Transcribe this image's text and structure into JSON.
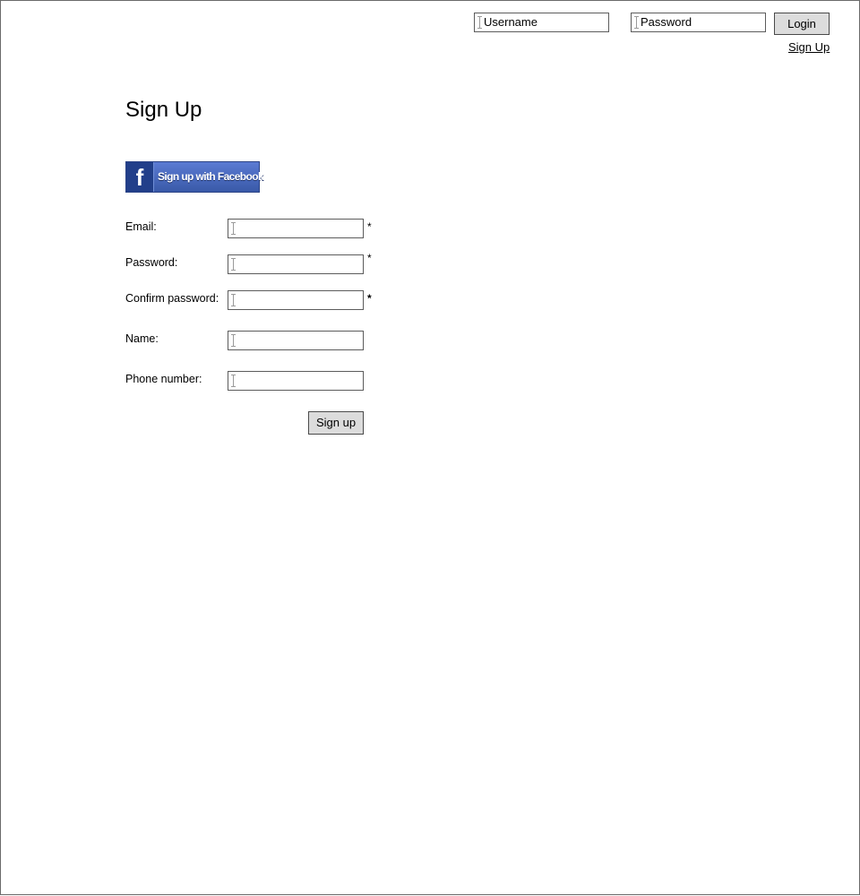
{
  "header": {
    "username_placeholder": "Username",
    "password_placeholder": "Password",
    "login_label": "Login",
    "signup_link": "Sign Up"
  },
  "page": {
    "title": "Sign Up"
  },
  "facebook": {
    "icon_glyph": "f",
    "label": "Sign up with Facebook",
    "color": "#3b5998"
  },
  "form": {
    "fields": [
      {
        "label": "Email:",
        "required_mark": "*"
      },
      {
        "label": "Password:",
        "required_mark": "*"
      },
      {
        "label": "Confirm password:",
        "required_mark": "*"
      },
      {
        "label": "Name:",
        "required_mark": ""
      },
      {
        "label": "Phone number:",
        "required_mark": ""
      }
    ],
    "submit_label": "Sign up"
  }
}
